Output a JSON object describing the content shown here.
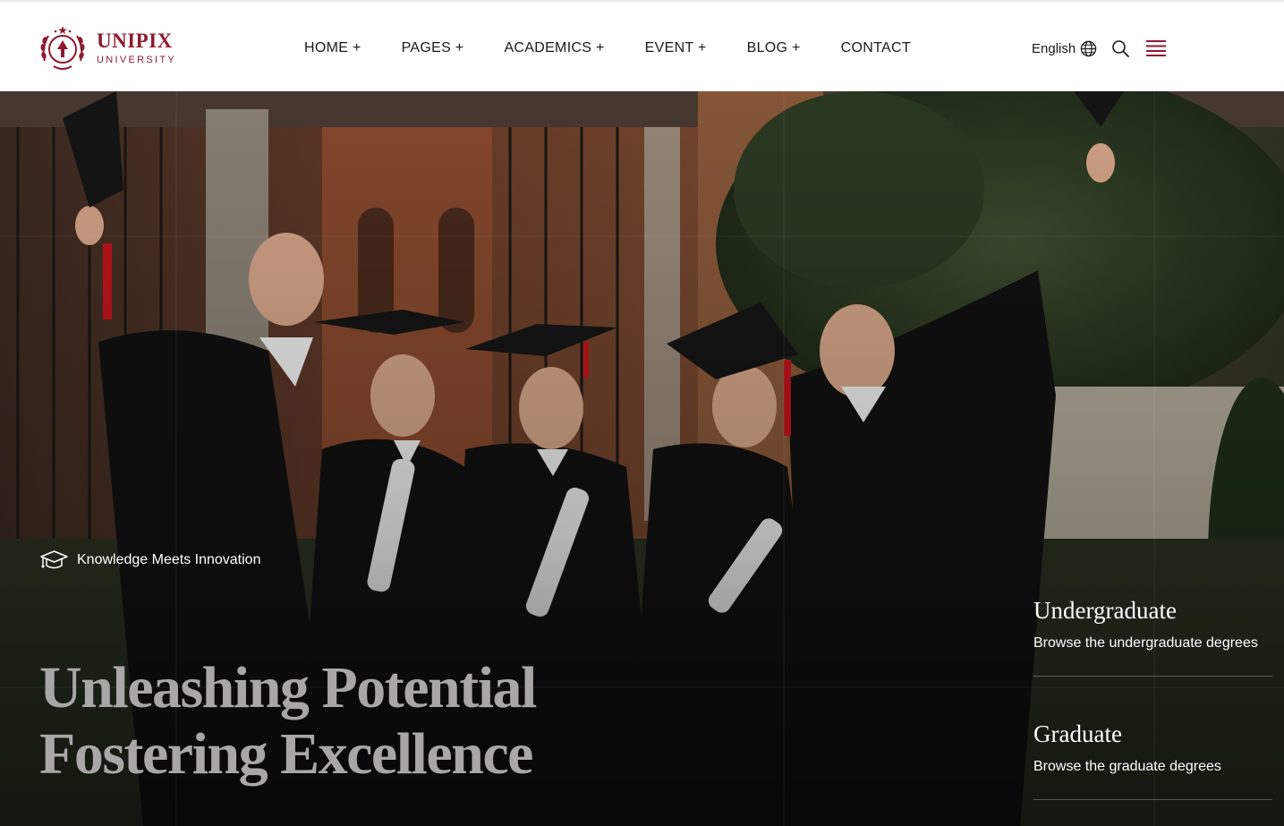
{
  "brand": {
    "name": "UNIPIX",
    "subtitle": "UNIVERSITY",
    "color": "#8e1a2e"
  },
  "nav": {
    "items": [
      {
        "label": "HOME +"
      },
      {
        "label": "PAGES +"
      },
      {
        "label": "ACADEMICS +"
      },
      {
        "label": "EVENT +"
      },
      {
        "label": "BLOG +"
      },
      {
        "label": "CONTACT"
      }
    ]
  },
  "header_actions": {
    "language_label": "English",
    "language_icon": "globe-icon",
    "search_icon": "search-icon",
    "menu_icon": "hamburger-menu-icon"
  },
  "hero": {
    "tagline": "Knowledge Meets Innovation",
    "tagline_icon": "graduation-cap-icon",
    "headline_line1": "Unleashing Potential",
    "headline_line2": "Fostering Excellence",
    "programs": [
      {
        "title": "Undergraduate",
        "description": "Browse the undergraduate degrees"
      },
      {
        "title": "Graduate",
        "description": "Browse the graduate degrees"
      }
    ]
  }
}
